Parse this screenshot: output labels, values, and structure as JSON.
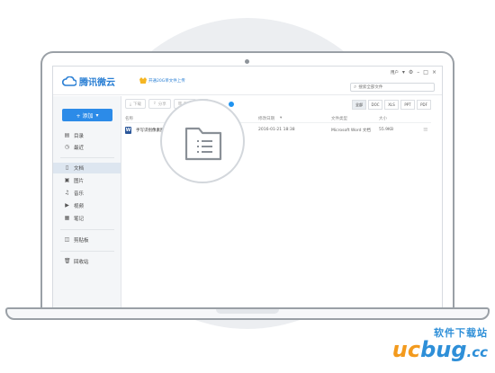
{
  "app": {
    "logo_text": "腾讯微云",
    "vip_text": "开通20G单文件上传",
    "user_name": "用户",
    "search_placeholder": "搜索全部文件"
  },
  "sidebar": {
    "add_label": "+ 添加",
    "items": [
      {
        "label": "目录",
        "icon": "list-icon"
      },
      {
        "label": "最近",
        "icon": "clock-icon"
      },
      {
        "label": "文档",
        "icon": "document-icon",
        "active": true
      },
      {
        "label": "图片",
        "icon": "image-icon"
      },
      {
        "label": "音乐",
        "icon": "music-icon"
      },
      {
        "label": "视频",
        "icon": "video-icon"
      },
      {
        "label": "笔记",
        "icon": "note-icon"
      },
      {
        "label": "剪贴板",
        "icon": "clipboard-icon"
      },
      {
        "label": "回收站",
        "icon": "trash-icon"
      }
    ]
  },
  "toolbar": {
    "download": "下载",
    "share": "分享",
    "delete": "删除"
  },
  "filters": [
    "全部",
    "DOC",
    "XLS",
    "PPT",
    "PDF"
  ],
  "table": {
    "headers": {
      "name": "名称",
      "modified": "修改日期",
      "type": "文件类型",
      "size": "大小"
    },
    "rows": [
      {
        "name": "手写识别像素图的对应关系.docx",
        "modified": "2016-01-21 18:38",
        "type": "Microsoft Word 文档",
        "size": "55.9KB"
      }
    ]
  },
  "watermark": {
    "top": "软件下载站",
    "brand_left": "uc",
    "brand_right": "bug",
    "brand_suffix": ".cc"
  },
  "colors": {
    "accent": "#2c8be8",
    "ring_dot": "#1f93f0",
    "word": "#2b579a",
    "watermark_orange": "#f39a1d"
  }
}
